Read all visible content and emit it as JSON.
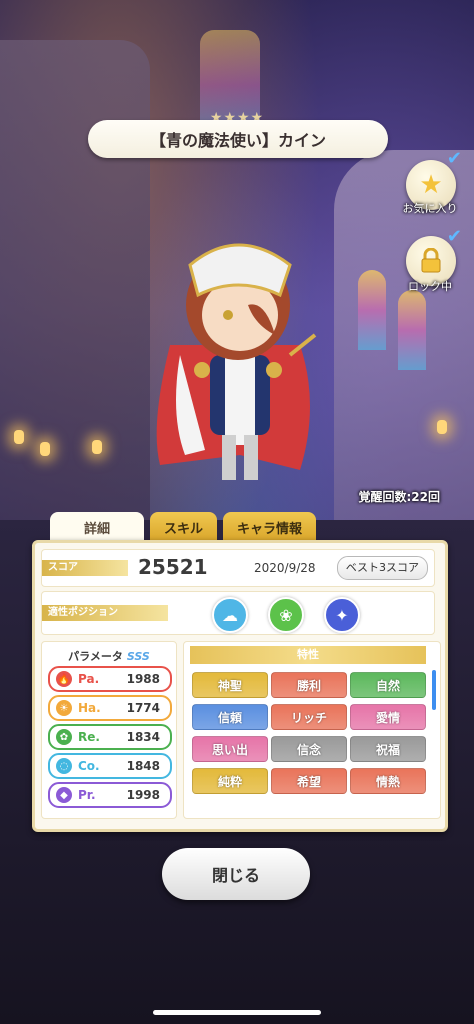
{
  "header": {
    "stars": "★★★★",
    "character_title": "【青の魔法使い】カイン"
  },
  "side_buttons": {
    "favorite_label": "お気に入り",
    "lock_label": "ロック中"
  },
  "awaken_count": "覚醒回数:22回",
  "tabs": [
    "詳細",
    "スキル",
    "キャラ情報"
  ],
  "score": {
    "label": "スコア",
    "value": "25521",
    "date": "2020/9/28",
    "best_button": "ベスト3スコア"
  },
  "position": {
    "label": "適性ポジション",
    "icons": [
      {
        "name": "cloud-position-icon",
        "color": "#4fb6e6",
        "glyph": "☁"
      },
      {
        "name": "leaf-position-icon",
        "color": "#5cc24a",
        "glyph": "❀"
      },
      {
        "name": "rocket-position-icon",
        "color": "#4a5fd8",
        "glyph": "✦"
      }
    ]
  },
  "params": {
    "label": "パラメータ",
    "rank": "SSS",
    "items": [
      {
        "name": "Pa.",
        "value": "1988",
        "color": "#e8524a",
        "glyph": "🔥"
      },
      {
        "name": "Ha.",
        "value": "1774",
        "color": "#f2a93b",
        "glyph": "☀"
      },
      {
        "name": "Re.",
        "value": "1834",
        "color": "#4bb04f",
        "glyph": "✿"
      },
      {
        "name": "Co.",
        "value": "1848",
        "color": "#43b7e0",
        "glyph": "◌"
      },
      {
        "name": "Pr.",
        "value": "1998",
        "color": "#8b5ad6",
        "glyph": "◆"
      }
    ]
  },
  "traits": {
    "label": "特性",
    "items": [
      {
        "label": "神聖",
        "color": "#e3b93a"
      },
      {
        "label": "勝利",
        "color": "#e9745a"
      },
      {
        "label": "自然",
        "color": "#5cb85c"
      },
      {
        "label": "信頼",
        "color": "#5a8fe0"
      },
      {
        "label": "リッチ",
        "color": "#e9745a"
      },
      {
        "label": "愛情",
        "color": "#e675a8"
      },
      {
        "label": "思い出",
        "color": "#e675a8"
      },
      {
        "label": "信念",
        "color": "#9a9a9a"
      },
      {
        "label": "祝福",
        "color": "#9a9a9a"
      },
      {
        "label": "純粋",
        "color": "#e3b93a"
      },
      {
        "label": "希望",
        "color": "#e9745a"
      },
      {
        "label": "情熱",
        "color": "#e9745a"
      }
    ]
  },
  "close_button": "閉じる"
}
